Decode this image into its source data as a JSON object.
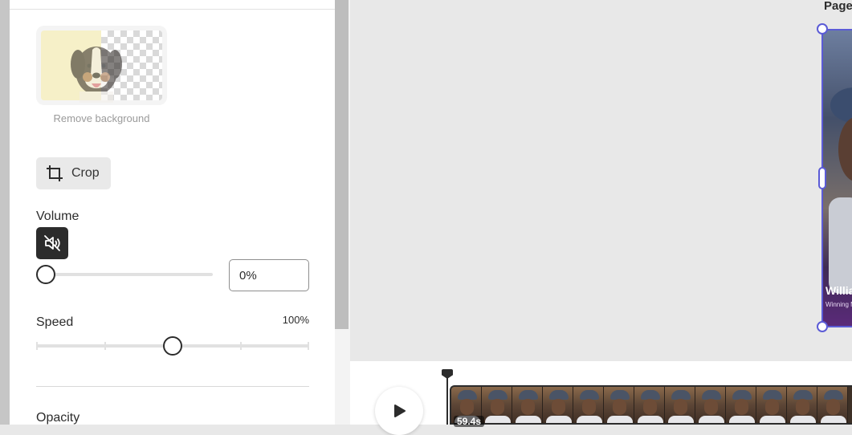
{
  "panel": {
    "remove_background_label": "Remove background",
    "crop_label": "Crop",
    "volume": {
      "label": "Volume",
      "value": "0%",
      "level": 0
    },
    "speed": {
      "label": "Speed",
      "value": "100%",
      "level": 0.5
    },
    "opacity_label": "Opacity"
  },
  "canvas": {
    "page_label": "Page",
    "page_title": "Willia",
    "page_subtitle": "Winning M"
  },
  "timeline": {
    "duration": "59.4s",
    "thumbnail_count": 13
  },
  "icons": {
    "crop": "crop-icon",
    "mute": "volume-mute-icon",
    "play": "play-icon"
  },
  "colors": {
    "selection_accent": "#5b5bd6",
    "dark_control": "#2c2c2c"
  }
}
